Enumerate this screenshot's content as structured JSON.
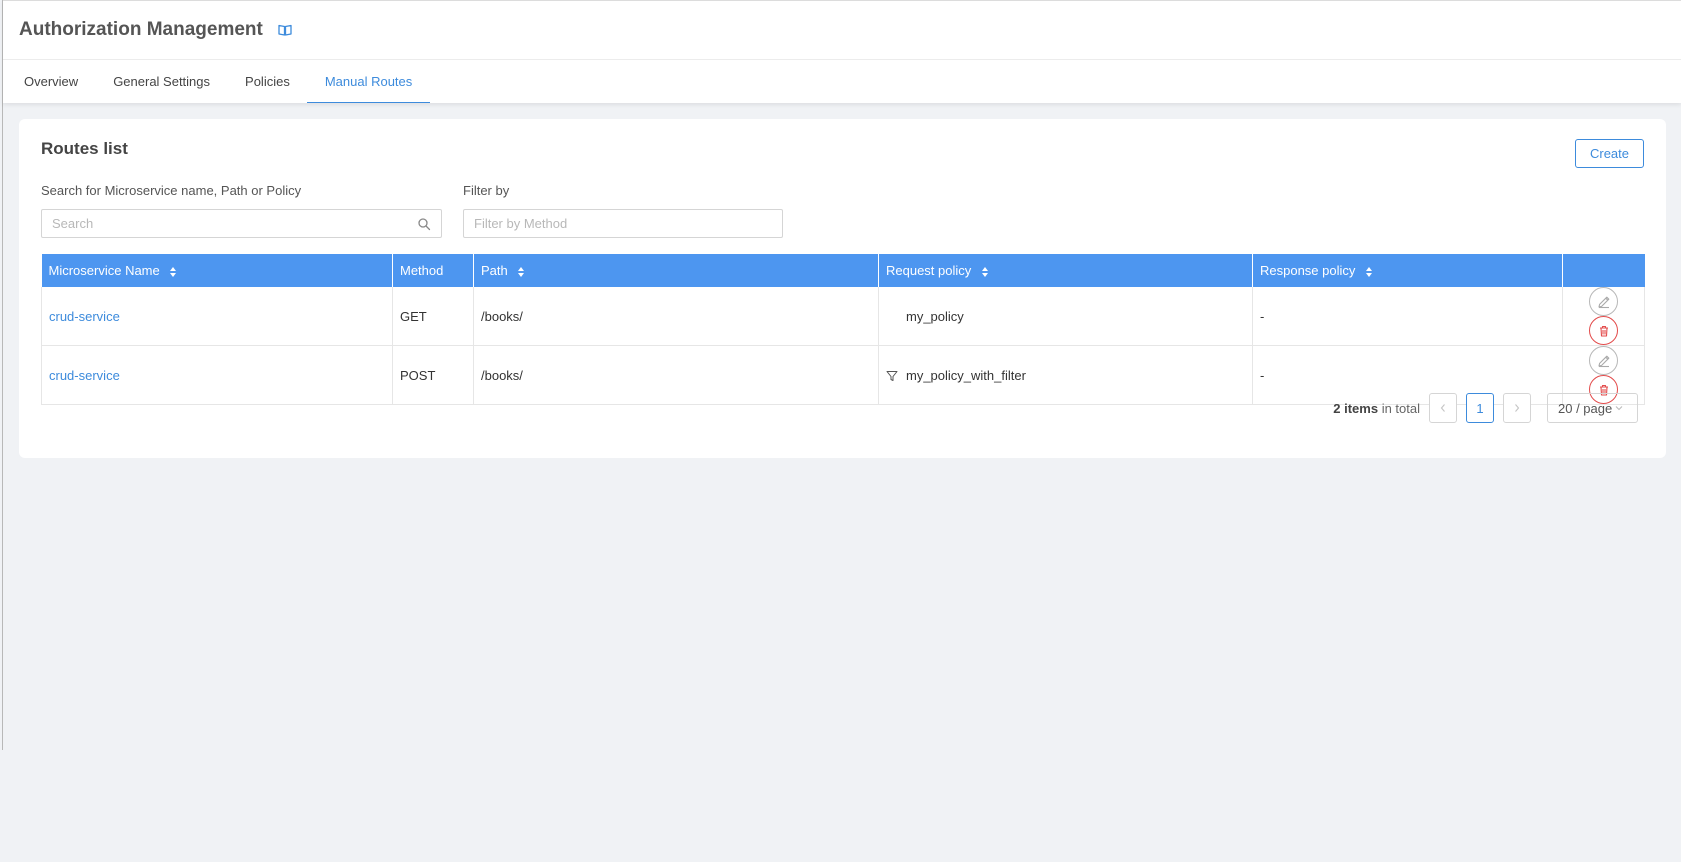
{
  "header": {
    "title": "Authorization Management",
    "tabs": [
      {
        "label": "Overview"
      },
      {
        "label": "General Settings"
      },
      {
        "label": "Policies"
      },
      {
        "label": "Manual Routes",
        "active": true
      }
    ]
  },
  "card": {
    "title": "Routes list",
    "create_label": "Create",
    "search_label": "Search for Microservice name, Path or Policy",
    "search_placeholder": "Search",
    "filter_label": "Filter by",
    "filter_placeholder": "Filter by Method"
  },
  "table": {
    "columns": [
      "Microservice Name",
      "Method",
      "Path",
      "Request policy",
      "Response policy"
    ],
    "rows": [
      {
        "microservice": "crud-service",
        "method": "GET",
        "path": "/books/",
        "request_policy": "my_policy",
        "request_policy_icon": "none",
        "response_policy": "-"
      },
      {
        "microservice": "crud-service",
        "method": "POST",
        "path": "/books/",
        "request_policy": "my_policy_with_filter",
        "request_policy_icon": "filter-icon",
        "response_policy": "-"
      }
    ]
  },
  "pagination": {
    "total_count": "2 items",
    "total_suffix": " in total",
    "current_page": "1",
    "page_size": "20 / page"
  },
  "colors": {
    "accent": "#3d8bdc",
    "table_header": "#4d96f0",
    "danger": "#e34b4b"
  }
}
